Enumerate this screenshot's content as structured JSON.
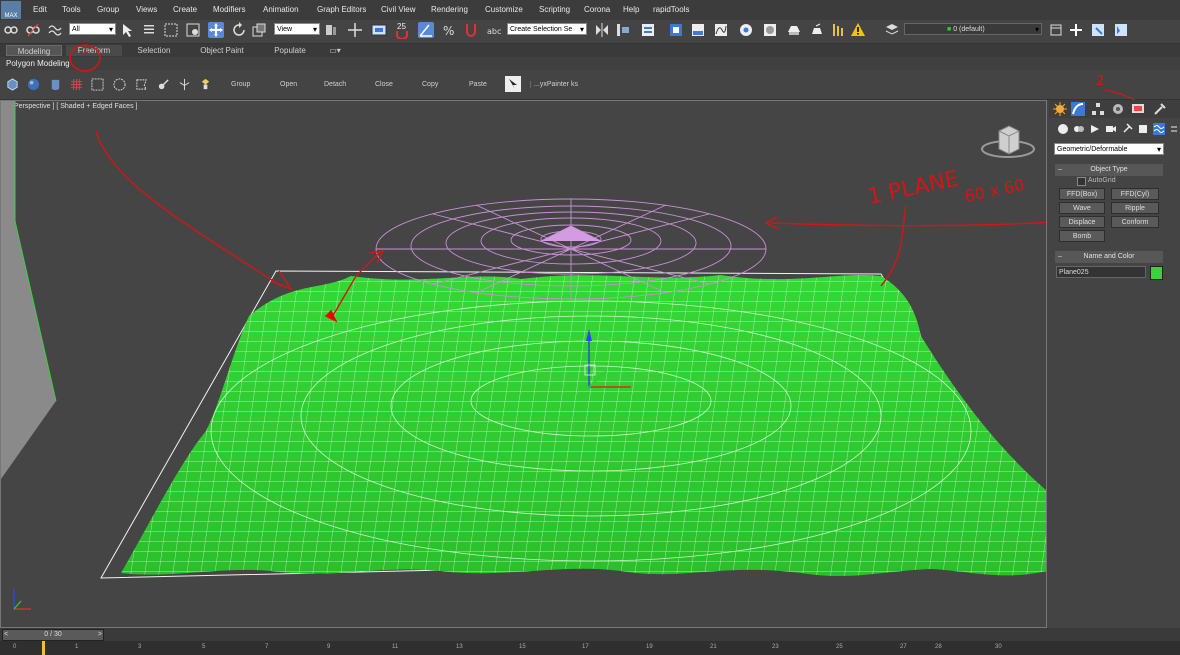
{
  "app": {
    "logo_text": "MAX"
  },
  "menu": [
    "Edit",
    "Tools",
    "Group",
    "Views",
    "Create",
    "Modifiers",
    "Animation",
    "Graph Editors",
    "Civil View",
    "Rendering",
    "Customize",
    "Scripting",
    "Corona",
    "Help",
    "rapidTools"
  ],
  "toolbar": {
    "filter_value": "All",
    "refcoord_value": "View",
    "snap_angle": "25",
    "selection_set_placeholder": "Create Selection Se",
    "layer_value": "0 (default)"
  },
  "ribbon": {
    "tabs": [
      "Modeling",
      "Freeform",
      "Selection",
      "Object Paint",
      "Populate"
    ],
    "panel_label": "Polygon Modeling",
    "tools": [
      "Group",
      "Open",
      "Detach",
      "Close",
      "Copy",
      "Paste"
    ],
    "painter_label": "...yxPainter ks"
  },
  "viewport": {
    "label": "+ [ Perspective ] [ Shaded + Edged Faces ]"
  },
  "annotations": {
    "note_plane": "1 PLANE",
    "note_size": "60 x 60",
    "marker_1": "1",
    "marker_2": "2"
  },
  "command_panel": {
    "category": "Geometric/Deformable",
    "object_type_title": "Object Type",
    "autogrid_label": "AutoGrid",
    "buttons": [
      "FFD(Box)",
      "FFD(Cyl)",
      "Wave",
      "Ripple",
      "Displace",
      "Conform",
      "Bomb"
    ],
    "name_color_title": "Name and Color",
    "object_name": "Plane025",
    "object_color": "#3ad13a"
  },
  "timeline": {
    "frame_readout": "0 / 30",
    "ticks": [
      "0",
      "1",
      "3",
      "5",
      "7",
      "9",
      "11",
      "13",
      "15",
      "17",
      "19",
      "21",
      "23",
      "25",
      "27",
      "28",
      "30"
    ]
  },
  "colors": {
    "mesh_green": "#2fd12f",
    "gizmo_purple": "#c98fd8",
    "annotation_red": "#d41515",
    "accent_blue": "#3a7ad6"
  }
}
